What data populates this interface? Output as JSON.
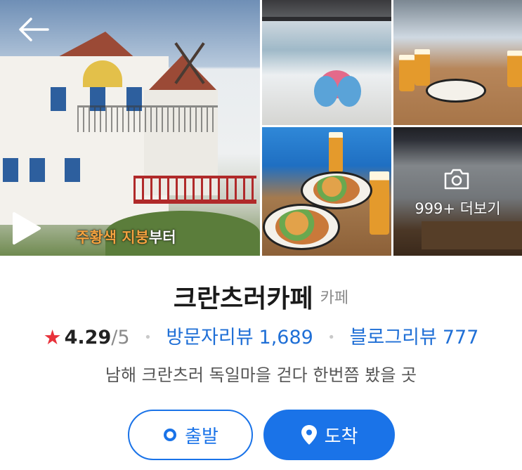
{
  "gallery": {
    "video_caption_highlight": "주황색 지붕",
    "video_caption_rest": "부터",
    "more_photos_label": "999+ 더보기"
  },
  "place": {
    "name": "크란츠러카페",
    "category": "카페",
    "rating": "4.29",
    "rating_max": "/5",
    "visitor_reviews_label": "방문자리뷰",
    "visitor_reviews_count": "1,689",
    "blog_reviews_label": "블로그리뷰",
    "blog_reviews_count": "777",
    "description": "남해 크란츠러 독일마을 걷다 한번쯤 봤을 곳"
  },
  "actions": {
    "start_label": "출발",
    "arrive_label": "도착"
  },
  "icons": {
    "back": "back-arrow-icon",
    "play": "play-icon",
    "camera": "camera-icon",
    "star": "star-icon",
    "origin": "origin-dot-icon",
    "pin": "location-pin-icon"
  },
  "colors": {
    "accent": "#1a73e8",
    "star": "#e8323b",
    "link": "#1f6fd6"
  }
}
